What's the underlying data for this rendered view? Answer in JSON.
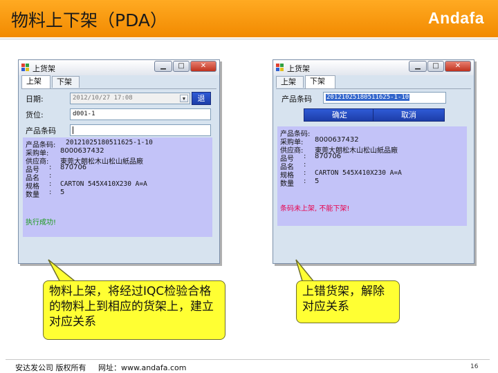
{
  "slide": {
    "title": "物料上下架（PDA）",
    "brand": "Andafa",
    "footer": "安达发公司 版权所有     网址：www.andafa.com",
    "page_number": "16"
  },
  "window_left": {
    "title": "上货架",
    "controls": {
      "minimize": "▁",
      "maximize": "□",
      "close": "✕"
    },
    "tabs": [
      "上架",
      "下架"
    ],
    "active_tab": 0,
    "date_label": "日期:",
    "date_value": "2012/10/27 17:08",
    "exit_button": "退",
    "shelf_label": "货位:",
    "shelf_value": "d001-1",
    "barcode_label": "产品条码",
    "barcode_value": "",
    "info_rows": [
      {
        "label": "产品条码:",
        "value": "20121025180511625-1-10"
      },
      {
        "label": "采购单:",
        "value": "8000637432"
      },
      {
        "label": "供应商:",
        "value": "東莞大朗松木山松山紙品廠"
      },
      {
        "label": "品号",
        "sep": ":",
        "value": "870706"
      },
      {
        "label": "品名",
        "sep": ":",
        "value": ""
      },
      {
        "label": "规格",
        "sep": ":",
        "value": "CARTON 545X410X230 A=A"
      },
      {
        "label": "数量",
        "sep": ":",
        "value": "5"
      }
    ],
    "message": "执行成功!",
    "message_color": "#1a9a1a"
  },
  "window_right": {
    "title": "上货架",
    "controls": {
      "minimize": "▁",
      "maximize": "□",
      "close": "✕"
    },
    "tabs": [
      "上架",
      "下架"
    ],
    "active_tab": 1,
    "barcode_label": "产品条码",
    "barcode_value": "20121025180511625-1-10",
    "confirm_button": "确定",
    "cancel_button": "取消",
    "info_rows": [
      {
        "label": "产品条码:",
        "value": ""
      },
      {
        "label": "采购单:",
        "value": "8000637432"
      },
      {
        "label": "供应商:",
        "value": "東莞大朗松木山松山紙品廠"
      },
      {
        "label": "品号",
        "sep": ":",
        "value": "870706"
      },
      {
        "label": "品名",
        "sep": ":",
        "value": ""
      },
      {
        "label": "规格",
        "sep": ":",
        "value": "CARTON 545X410X230 A=A"
      },
      {
        "label": "数量",
        "sep": ":",
        "value": "5"
      }
    ],
    "message": "条码未上架, 不能下架!",
    "message_color": "#e8004c"
  },
  "callout_left": "物料上架，将经过IQC检验合格的物料上到相应的货架上，建立对应关系",
  "callout_right": "上错货架，解除对应关系",
  "colors": {
    "header": "#f7941d",
    "callout": "#ffff33",
    "info_panel": "#c3c3f8",
    "button": "#2448c0"
  }
}
